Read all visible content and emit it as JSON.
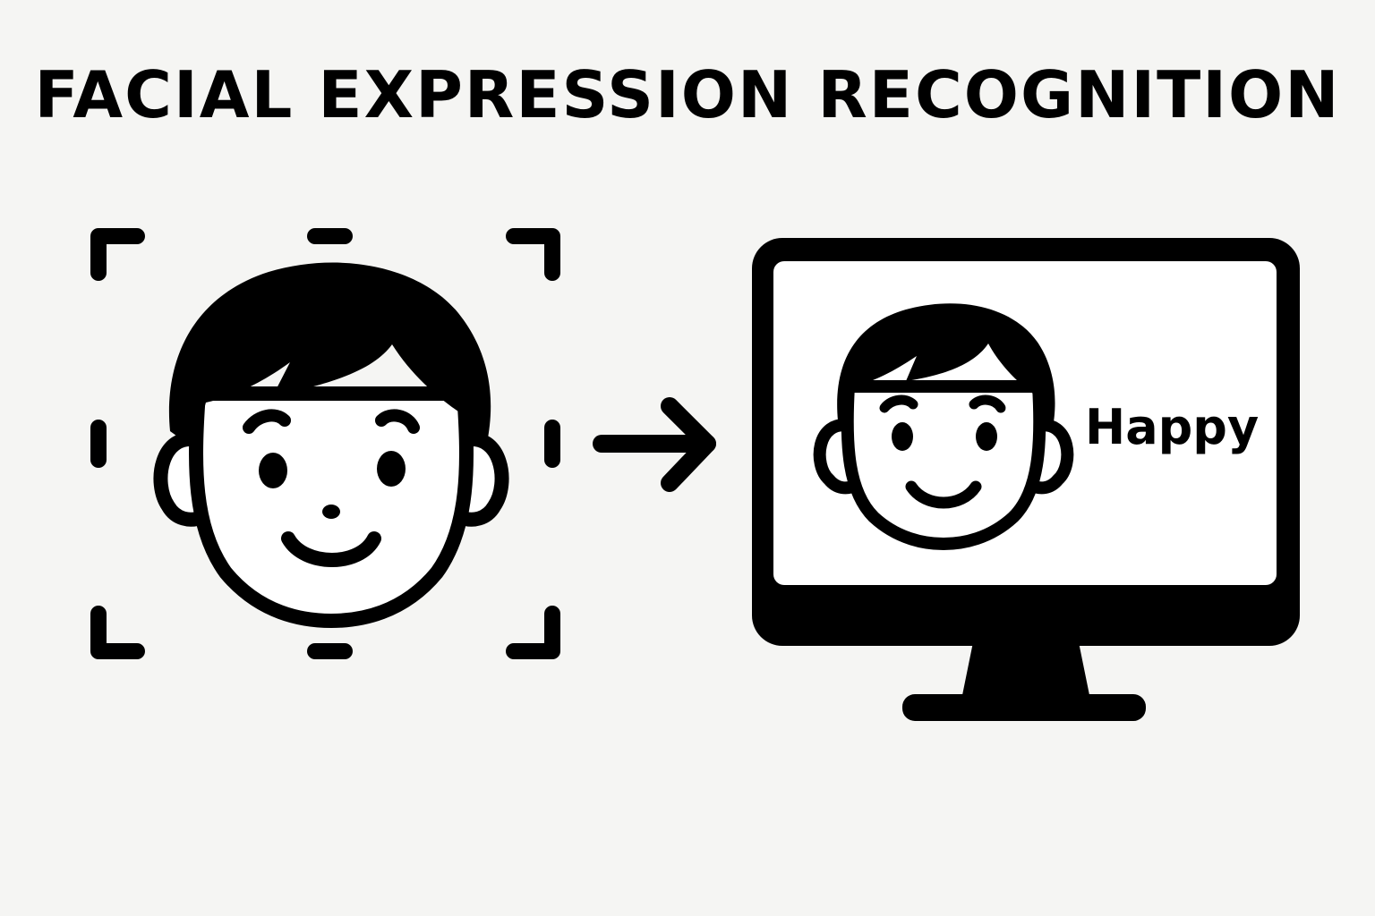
{
  "title": "FACIAL EXPRESSION RECOGNITION",
  "expression_label": "Happy",
  "colors": {
    "background": "#f5f5f3",
    "ink": "#000000",
    "screen": "#ffffff"
  },
  "icons": {
    "scan_frame": "face-scan-frame-icon",
    "input_face": "face-icon",
    "arrow": "arrow-right-icon",
    "monitor": "monitor-icon",
    "output_face": "face-icon"
  }
}
